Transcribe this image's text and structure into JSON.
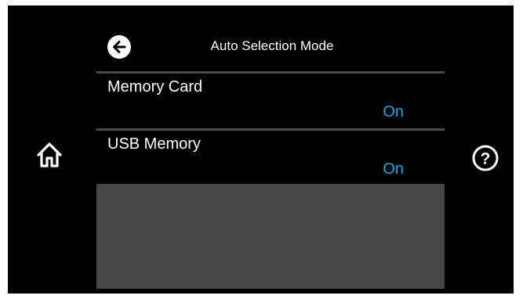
{
  "header": {
    "title": "Auto Selection Mode",
    "back_icon": "back-arrow-icon"
  },
  "nav": {
    "home_icon": "home-icon",
    "help_icon": "help-icon",
    "help_glyph": "?"
  },
  "settings": [
    {
      "label": "Memory Card",
      "value": "On"
    },
    {
      "label": "USB Memory",
      "value": "On"
    }
  ],
  "colors": {
    "background": "#000000",
    "value_accent": "#19a7e0",
    "divider": "#4a4a4a",
    "blank_area": "#464646"
  }
}
